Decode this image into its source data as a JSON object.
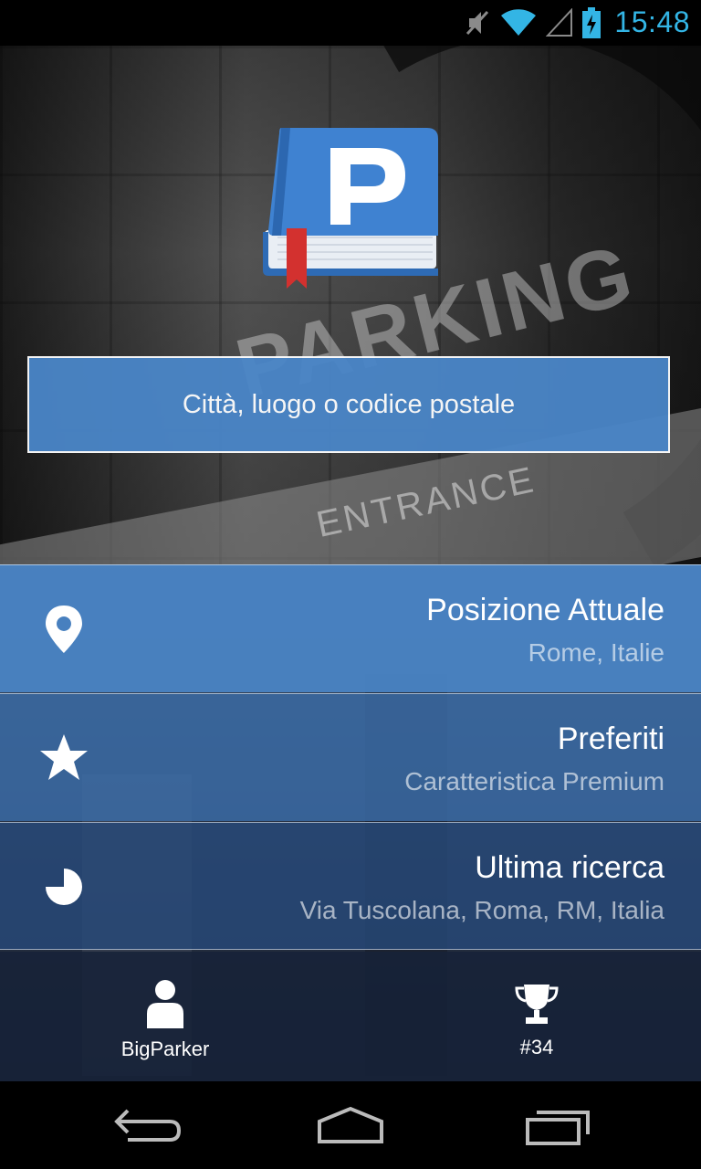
{
  "status_bar": {
    "time": "15:48",
    "icons": [
      "mute-icon",
      "wifi-icon",
      "signal-icon",
      "battery-charging-icon"
    ],
    "time_color": "#33b5e5"
  },
  "hero": {
    "background_words": [
      "PARKING",
      "ENTRANCE"
    ],
    "logo_letter": "P"
  },
  "search": {
    "placeholder": "Città, luogo o codice postale"
  },
  "menu": {
    "items": [
      {
        "title": "Posizione Attuale",
        "subtitle": "Rome, Italie",
        "icon": "location-pin-icon"
      },
      {
        "title": "Preferiti",
        "subtitle": "Caratteristica Premium",
        "icon": "star-icon"
      },
      {
        "title": "Ultima ricerca",
        "subtitle": "Via Tuscolana, Roma, RM, Italia",
        "icon": "history-pie-icon"
      }
    ]
  },
  "bottom_tabs": {
    "user": {
      "label": "BigParker",
      "icon": "user-icon"
    },
    "rank": {
      "label": "#34",
      "icon": "trophy-icon"
    }
  },
  "nav_bar": {
    "buttons": [
      "back-icon",
      "home-icon",
      "recent-apps-icon"
    ]
  },
  "colors": {
    "accent": "#4a86c8",
    "row_dark": "#274a7a"
  }
}
